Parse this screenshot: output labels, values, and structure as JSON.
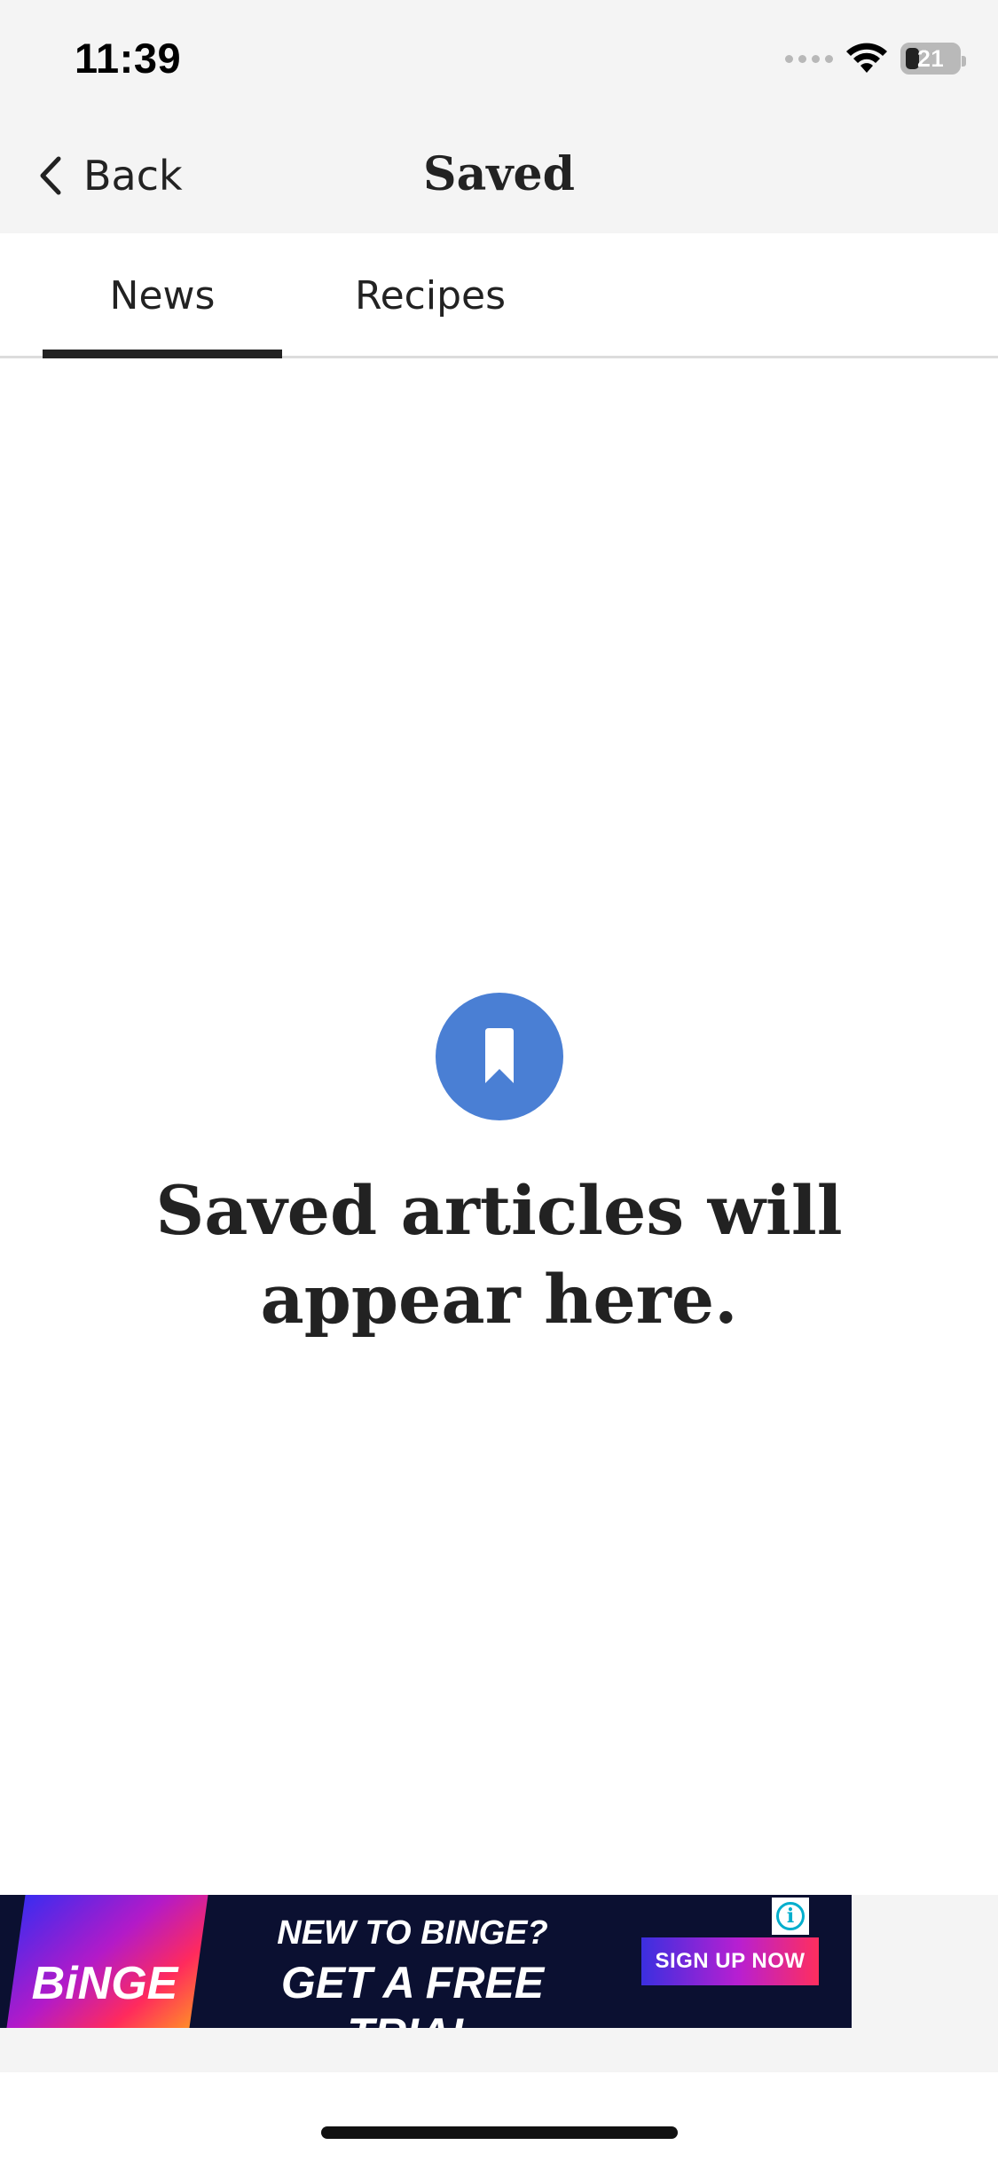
{
  "status_bar": {
    "time": "11:39",
    "battery_level": "21",
    "icons": [
      "signal-dots-icon",
      "wifi-icon",
      "battery-icon"
    ]
  },
  "nav": {
    "back_label": "Back",
    "title": "Saved",
    "back_icon": "chevron-left-icon"
  },
  "tabs": {
    "items": [
      {
        "label": "News",
        "selected": true
      },
      {
        "label": "Recipes",
        "selected": false
      }
    ]
  },
  "empty_state": {
    "icon": "bookmark-icon",
    "message": "Saved articles will appear here.",
    "icon_color": "#4a7fd4"
  },
  "ad": {
    "brand": "BiNGE",
    "headline_1": "NEW TO BINGE?",
    "headline_2": "GET A FREE TRIAL",
    "cta": "SIGN UP NOW",
    "info_glyph": "i",
    "info_icon": "info-icon"
  },
  "colors": {
    "header_bg": "#f4f4f4",
    "text": "#222222",
    "accent": "#4a7fd4",
    "ad_bg": "#0b1031"
  }
}
